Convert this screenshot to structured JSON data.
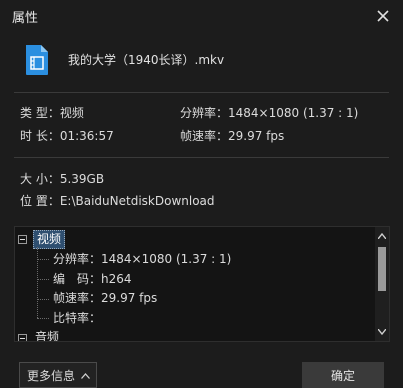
{
  "window": {
    "title": "属性",
    "close_icon": "close-icon"
  },
  "file": {
    "name": "我的大学（1940长译）.mkv",
    "icon": "video-file-icon",
    "icon_color": "#2b8fe0"
  },
  "basic": {
    "type_label": "类 型：",
    "type_value": "视频",
    "resolution_label": "分辨率：",
    "resolution_value": "1484×1080 (1.37 : 1)",
    "duration_label": "时 长：",
    "duration_value": "01:36:57",
    "framerate_label": "帧速率：",
    "framerate_value": "29.97 fps"
  },
  "location": {
    "size_label": "大 小：",
    "size_value": "5.39GB",
    "path_label": "位 置：",
    "path_value": "E:\\BaiduNetdiskDownload"
  },
  "tree": {
    "video_node": "视频",
    "video_children": [
      {
        "label": "分辨率：",
        "value": "1484×1080 (1.37 : 1)"
      },
      {
        "label": "编　码：",
        "value": "h264"
      },
      {
        "label": "帧速率：",
        "value": "29.97 fps"
      },
      {
        "label": "比特率：",
        "value": ""
      }
    ],
    "audio_node": "音频"
  },
  "buttons": {
    "more": "更多信息",
    "ok": "确定"
  },
  "colors": {
    "background": "#1c1c1c",
    "selection": "#2f4f70",
    "accent": "#2b8fe0"
  }
}
